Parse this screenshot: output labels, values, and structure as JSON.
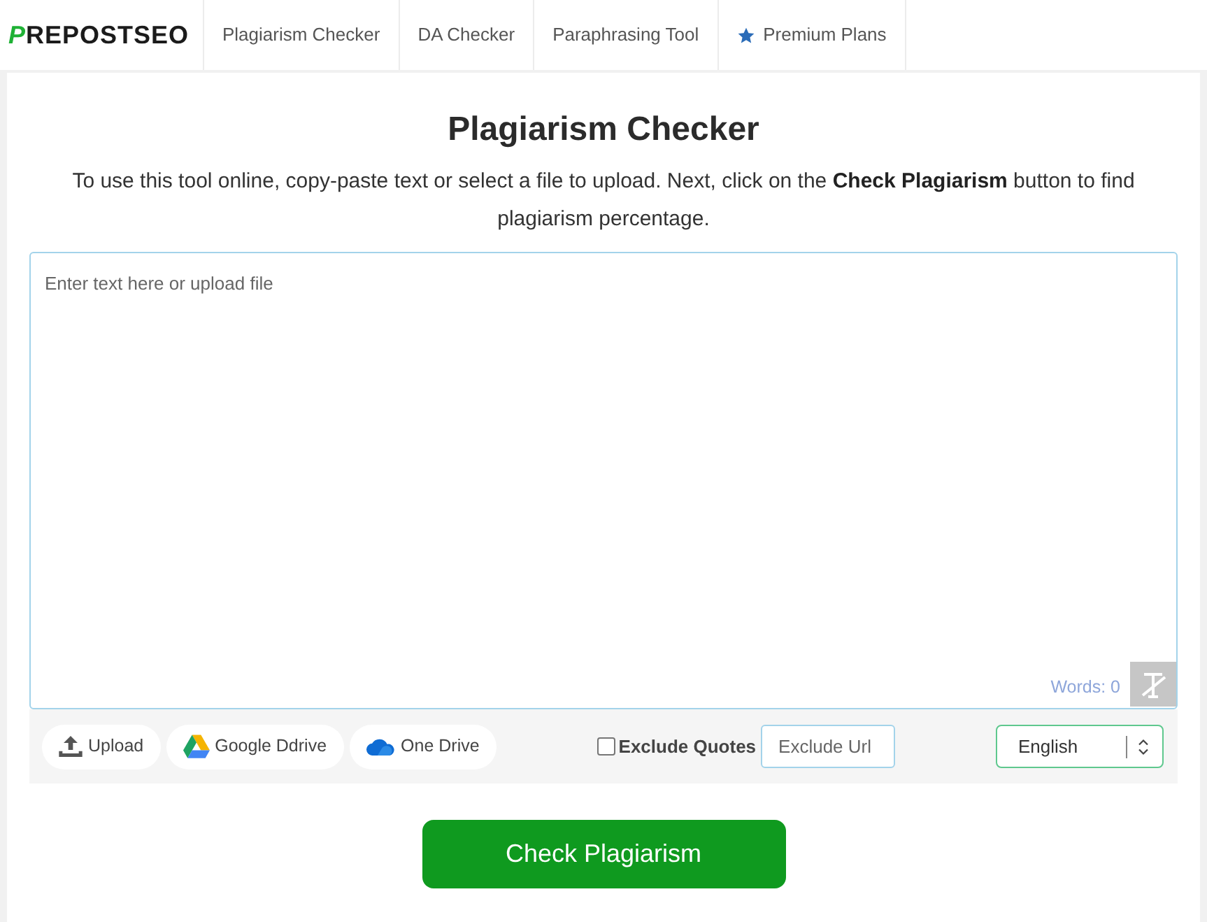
{
  "nav": {
    "logo": "PREPOSTSEO",
    "items": [
      {
        "label": "Plagiarism Checker",
        "kind": "link"
      },
      {
        "label": "DA Checker",
        "kind": "link"
      },
      {
        "label": "Paraphrasing Tool",
        "kind": "link"
      },
      {
        "label": "Premium Plans",
        "kind": "premium"
      }
    ]
  },
  "tool": {
    "title": "Plagiarism Checker",
    "description": "To use this tool online, copy-paste text or select a file to upload. Next, click on the **Check Plagiarism** button to find plagiarism percentage.",
    "editor": {
      "placeholder": "Enter text here or upload file",
      "word_count": "Words: 0"
    },
    "sources": [
      {
        "label": "Upload",
        "kind": "upload"
      },
      {
        "label": "Google Ddrive",
        "kind": "google-drive"
      },
      {
        "label": "One Drive",
        "kind": "onedrive"
      }
    ],
    "exclude_quotes": {
      "label": "Exclude Quotes",
      "checked": false
    },
    "exclude_url": {
      "placeholder": "Exclude Url"
    },
    "language": {
      "value": "English"
    },
    "submit": "Check Plagiarism"
  }
}
